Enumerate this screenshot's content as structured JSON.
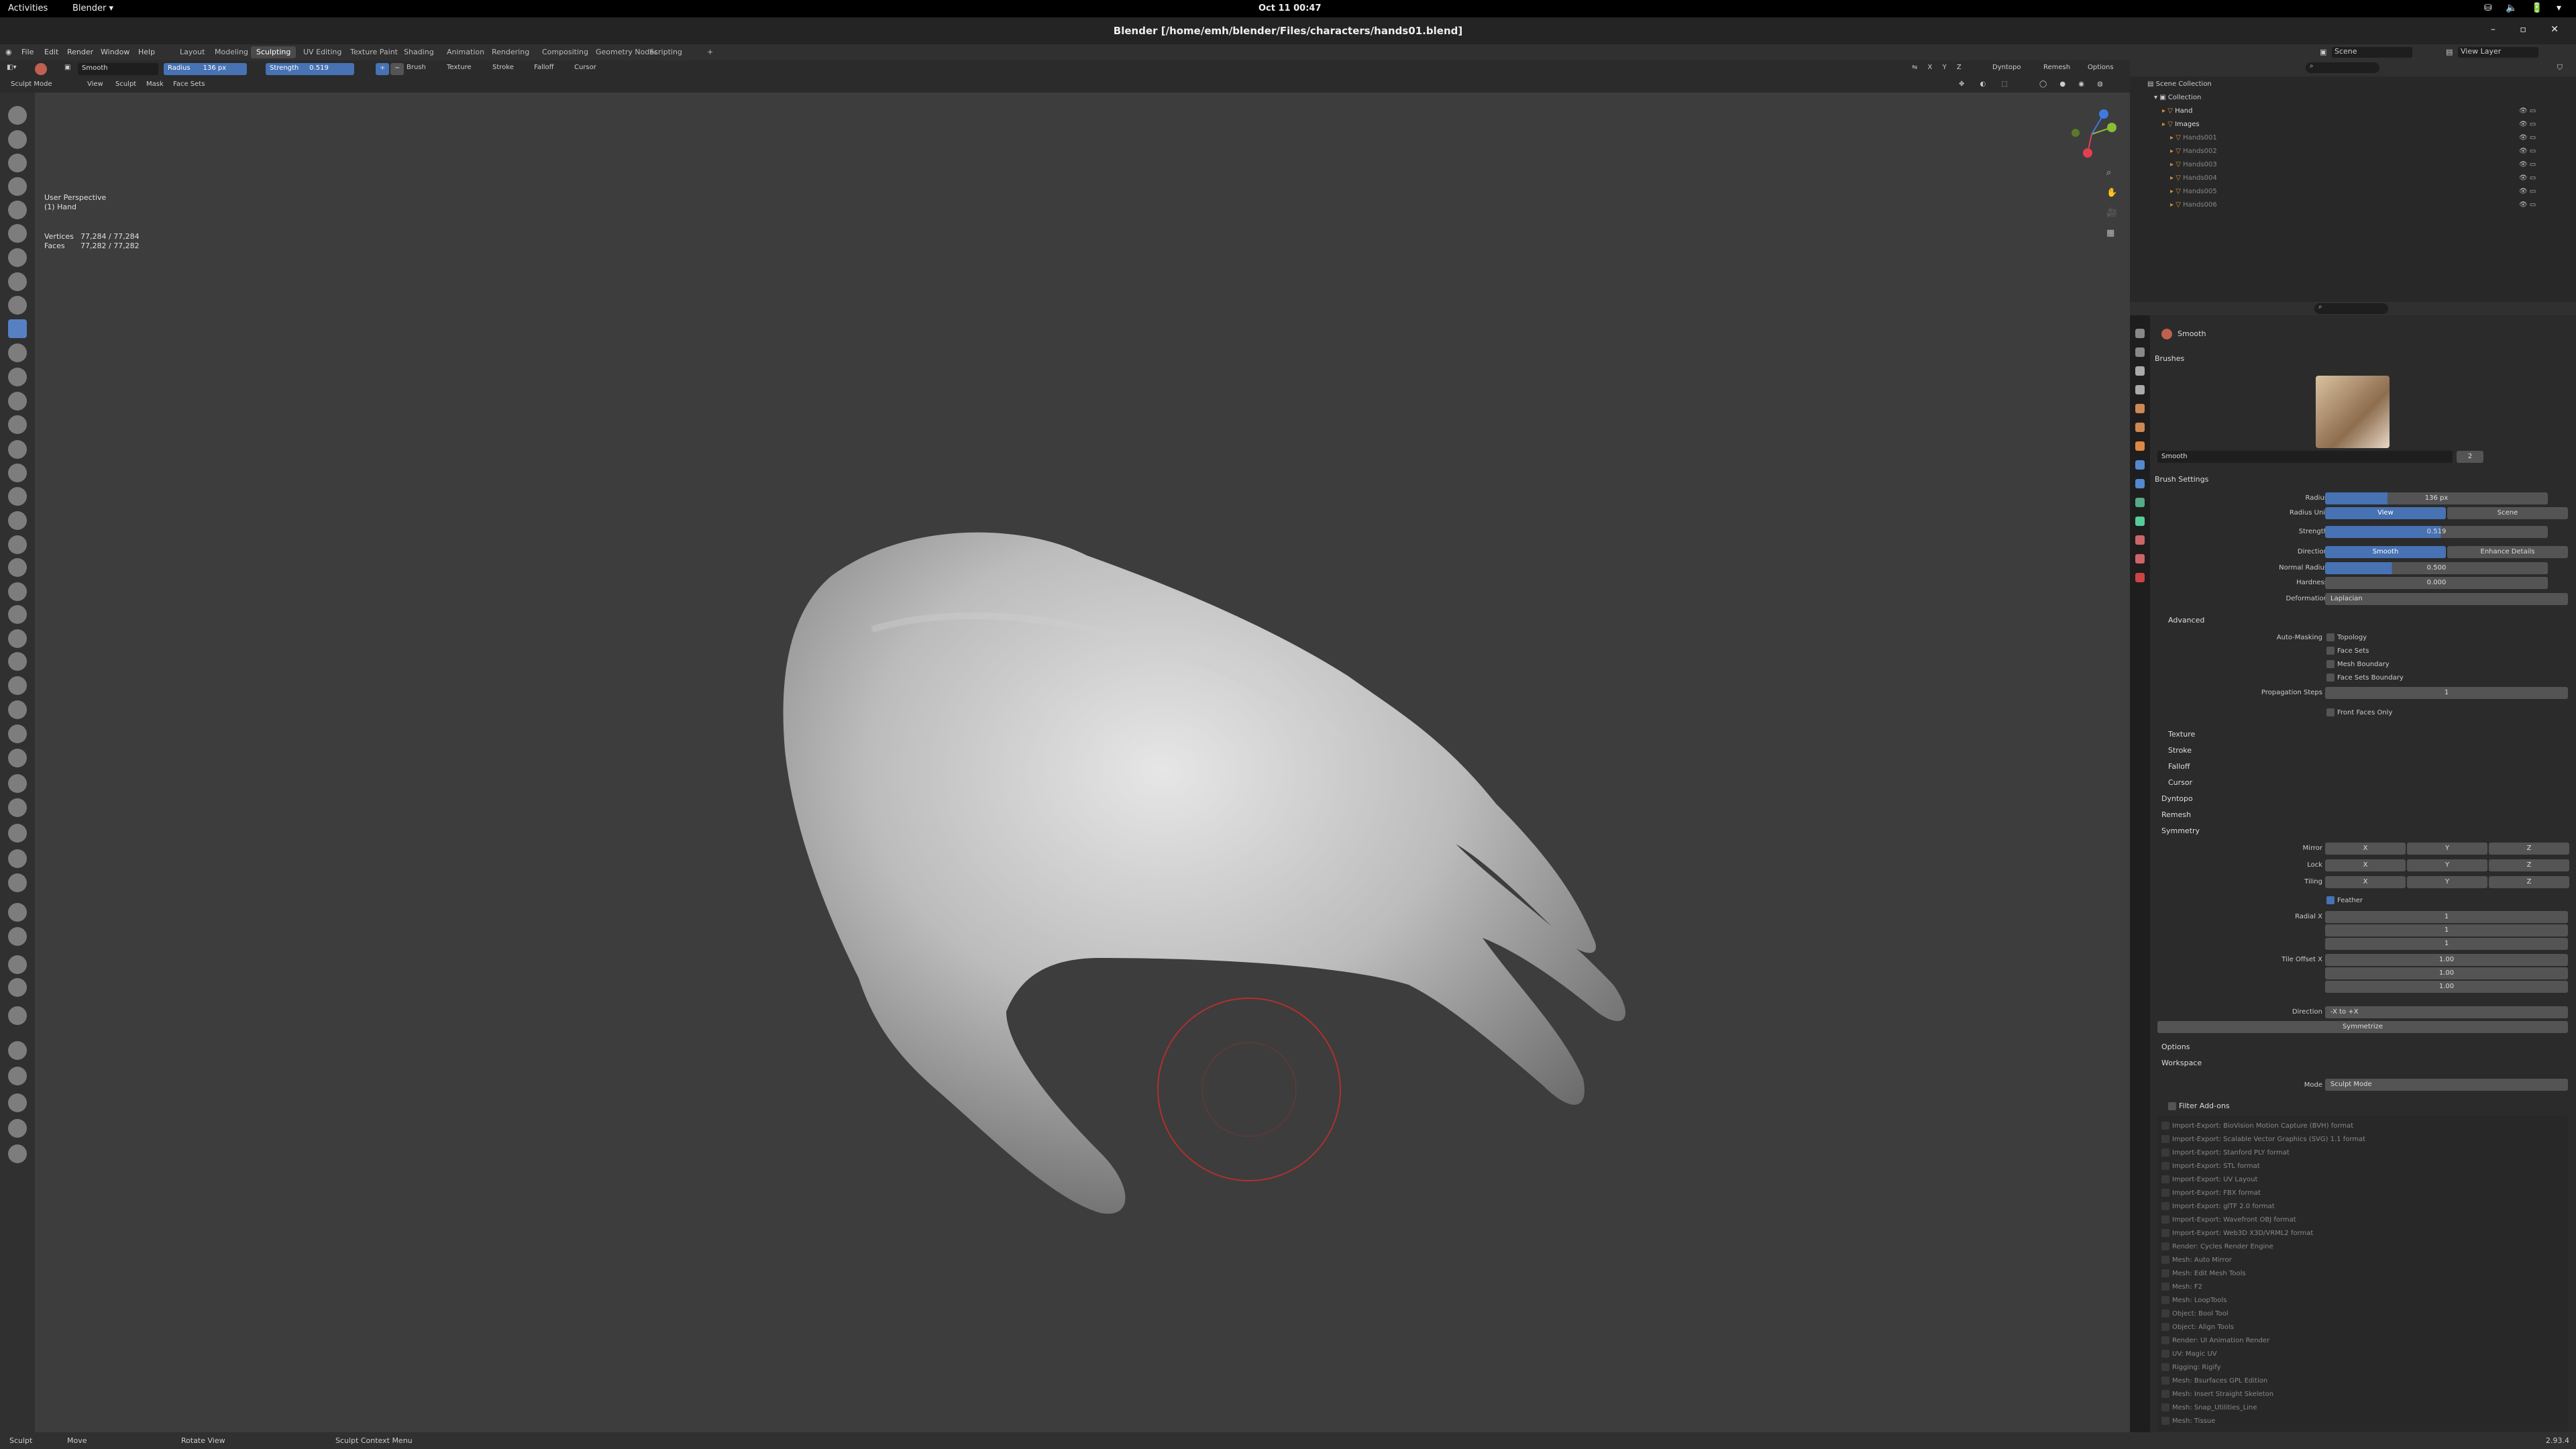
{
  "gnome": {
    "activities": "Activities",
    "app": "Blender ▾",
    "clock": "Oct 11  00:47",
    "tray": "⛁ 🔈 🔋 ▾"
  },
  "window": {
    "title": "Blender [/home/emh/blender/Files/characters/hands01.blend]",
    "buttons": "– ▫ ✕"
  },
  "menu": [
    "File",
    "Edit",
    "Render",
    "Window",
    "Help"
  ],
  "workspaces": [
    "Layout",
    "Modeling",
    "Sculpting",
    "UV Editing",
    "Texture Paint",
    "Shading",
    "Animation",
    "Rendering",
    "Compositing",
    "Geometry Nodes",
    "Scripting",
    "+"
  ],
  "active_workspace": "Sculpting",
  "scene": {
    "scene": "Scene",
    "view_layer": "View Layer"
  },
  "toolhdr": {
    "brush": "Smooth",
    "radius_label": "Radius",
    "radius": "136 px",
    "strength_label": "Strength",
    "strength": "0.519",
    "menus": [
      "Brush",
      "Texture",
      "Stroke",
      "Falloff",
      "Cursor"
    ],
    "right": [
      "Dyntopo",
      "Remesh",
      "Options"
    ]
  },
  "modehdr": {
    "mode": "Sculpt Mode",
    "menus": [
      "View",
      "Sculpt",
      "Mask",
      "Face Sets"
    ]
  },
  "overlay": {
    "view": "User Perspective",
    "object": "(1) Hand",
    "verts_label": "Vertices",
    "verts": "77,284 / 77,284",
    "faces_label": "Faces",
    "faces": "77,282 / 77,282"
  },
  "outliner": {
    "root": "Scene Collection",
    "collection": "Collection",
    "items": [
      "Hand",
      "Images",
      "Hands001",
      "Hands002",
      "Hands003",
      "Hands004",
      "Hands005",
      "Hands006"
    ]
  },
  "props": {
    "tool": "Smooth",
    "brushes": "Brushes",
    "brush_name": "Smooth",
    "brush_users": "2",
    "settings": "Brush Settings",
    "rows": [
      {
        "label": "Radius",
        "value": "136 px"
      },
      {
        "label": "Radius Unit",
        "a": "View",
        "b": "Scene"
      },
      {
        "label": "Strength",
        "value": "0.519"
      },
      {
        "label": "Direction",
        "a": "Smooth",
        "b": "Enhance Details"
      },
      {
        "label": "Normal Radius",
        "value": "0.500"
      },
      {
        "label": "Hardness",
        "value": "0.000"
      },
      {
        "label": "Deformation",
        "value": "Laplacian"
      }
    ],
    "advanced": "Advanced",
    "automasking": "Auto-Masking",
    "mask_opts": [
      "Topology",
      "Face Sets",
      "Mesh Boundary",
      "Face Sets Boundary"
    ],
    "prop_steps_label": "Propagation Steps",
    "prop_steps": "1",
    "front_faces": "Front Faces Only",
    "subs": [
      "Texture",
      "Stroke",
      "Falloff",
      "Cursor"
    ],
    "dyntopo": "Dyntopo",
    "remesh": "Remesh",
    "symmetry": "Symmetry",
    "sym_rows": [
      "Mirror",
      "Lock",
      "Tiling"
    ],
    "xyz": [
      "X",
      "Y",
      "Z"
    ],
    "feather": "Feather",
    "radial_label": "Radial X",
    "radial": [
      "1",
      "1",
      "1"
    ],
    "tile_label": "Tile Offset X",
    "tile": [
      "1.00",
      "1.00",
      "1.00"
    ],
    "dir_label": "Direction",
    "dir_val": "-X to +X",
    "symmetrize": "Symmetrize",
    "options": "Options",
    "workspace": "Workspace",
    "mode_label": "Mode",
    "mode_val": "Sculpt Mode",
    "filter": "Filter Add-ons",
    "addons": [
      "Import-Export: BioVision Motion Capture (BVH) format",
      "Import-Export: Scalable Vector Graphics (SVG) 1.1 format",
      "Import-Export: Stanford PLY format",
      "Import-Export: STL format",
      "Import-Export: UV Layout",
      "Import-Export: FBX format",
      "Import-Export: glTF 2.0 format",
      "Import-Export: Wavefront OBJ format",
      "Import-Export: Web3D X3D/VRML2 format",
      "Render: Cycles Render Engine",
      "Mesh: Auto Mirror",
      "Mesh: Edit Mesh Tools",
      "Mesh: F2",
      "Mesh: LoopTools",
      "Object: Bool Tool",
      "Object: Align Tools",
      "Render: UI Animation Render",
      "UV: Magic UV",
      "Rigging: Rigify",
      "Mesh: Bsurfaces GPL Edition",
      "Mesh: Insert Straight Skeleton",
      "Mesh: Snap_Utilities_Line",
      "Mesh: Tissue"
    ]
  },
  "status": {
    "sculpt": "Sculpt",
    "move": "Move",
    "rotate": "Rotate View",
    "ctx": "Sculpt Context Menu",
    "ver": "2.93.4"
  }
}
